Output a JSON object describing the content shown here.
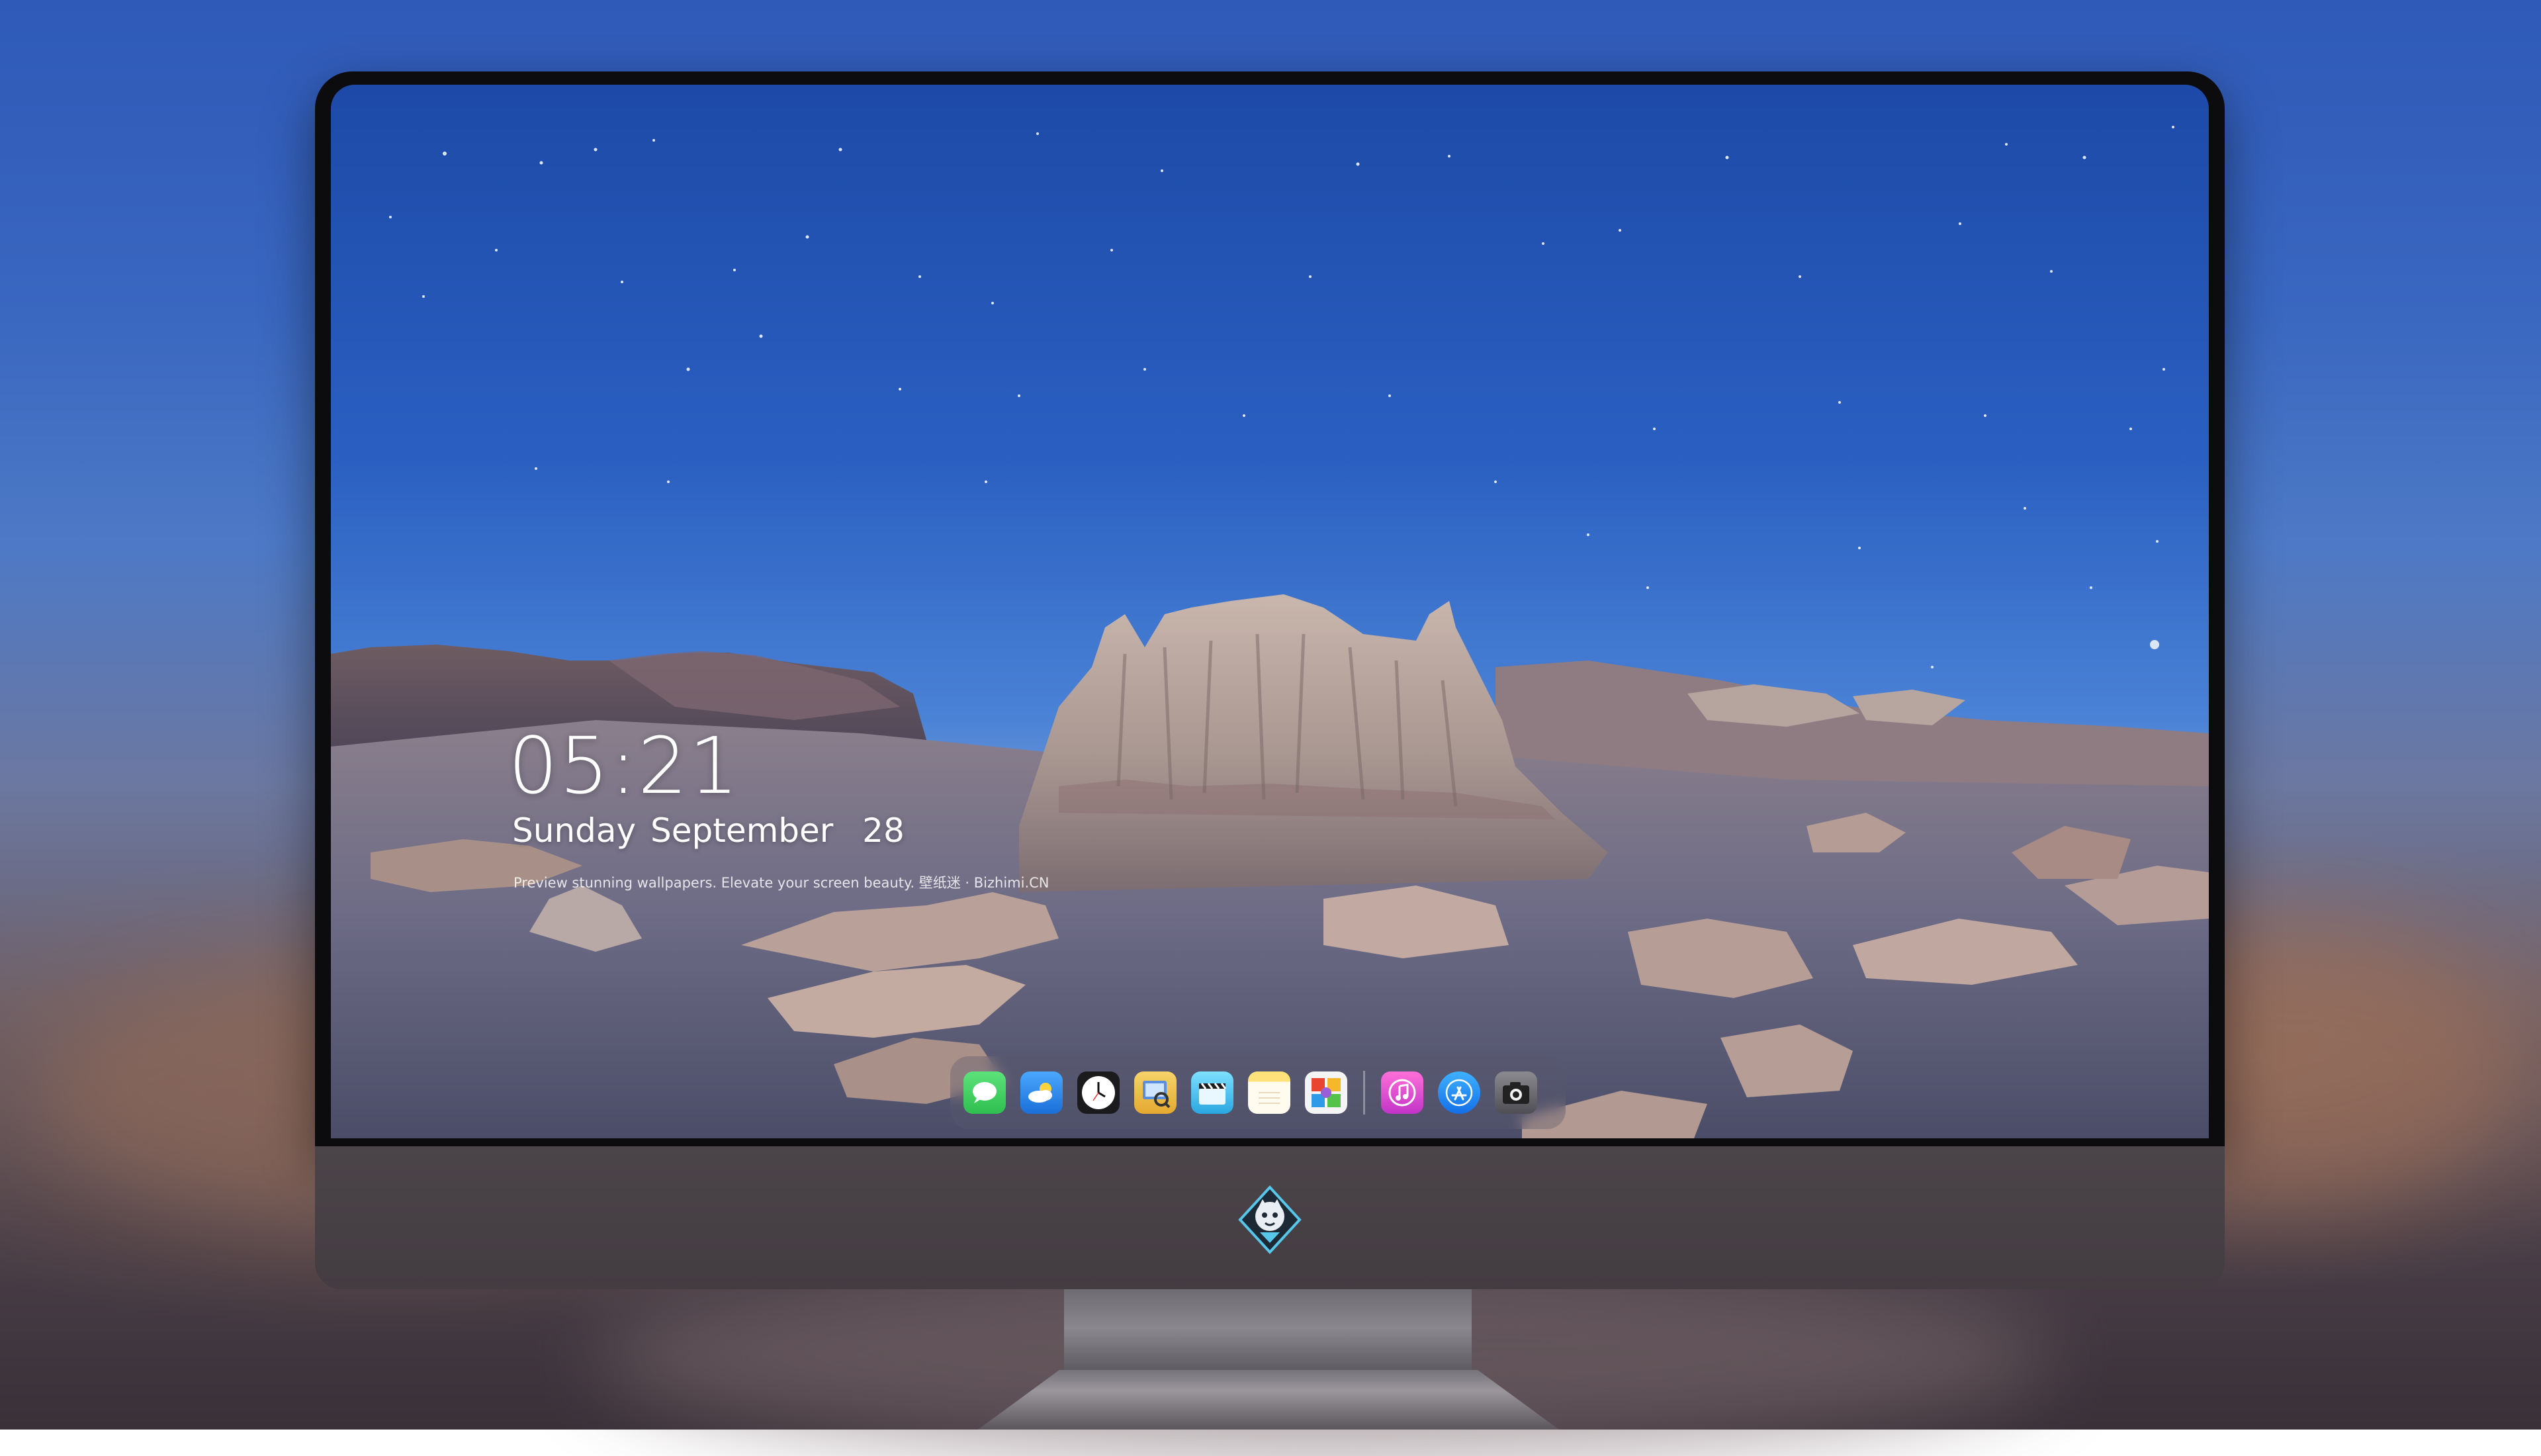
{
  "lockscreen": {
    "time": "05:21",
    "date": "Sunday September  28",
    "caption": "Preview stunning wallpapers. Elevate your screen beauty. 壁纸迷 · Bizhimi.CN"
  },
  "dock": {
    "apps": [
      {
        "name": "messages",
        "icon": "messages-icon",
        "color": "#34c759"
      },
      {
        "name": "weather",
        "icon": "weather-icon",
        "color": "#2f8cf0"
      },
      {
        "name": "clock",
        "icon": "clock-icon",
        "color": "#1a1a1a"
      },
      {
        "name": "preview",
        "icon": "preview-icon",
        "color": "#f2c94c"
      },
      {
        "name": "clips",
        "icon": "clips-icon",
        "color": "#27b5e8"
      },
      {
        "name": "notes",
        "icon": "notes-icon",
        "color": "#f7d54a"
      },
      {
        "name": "photos",
        "icon": "photos-icon",
        "color": "#ffffff"
      },
      {
        "name": "itunes",
        "icon": "music-icon",
        "color": "#e644c8"
      },
      {
        "name": "app-store",
        "icon": "app-store-icon",
        "color": "#1e8cf5"
      },
      {
        "name": "camera",
        "icon": "camera-icon",
        "color": "#6a6a70"
      }
    ]
  },
  "monitor": {
    "logo": "wallpaper-app-logo"
  }
}
